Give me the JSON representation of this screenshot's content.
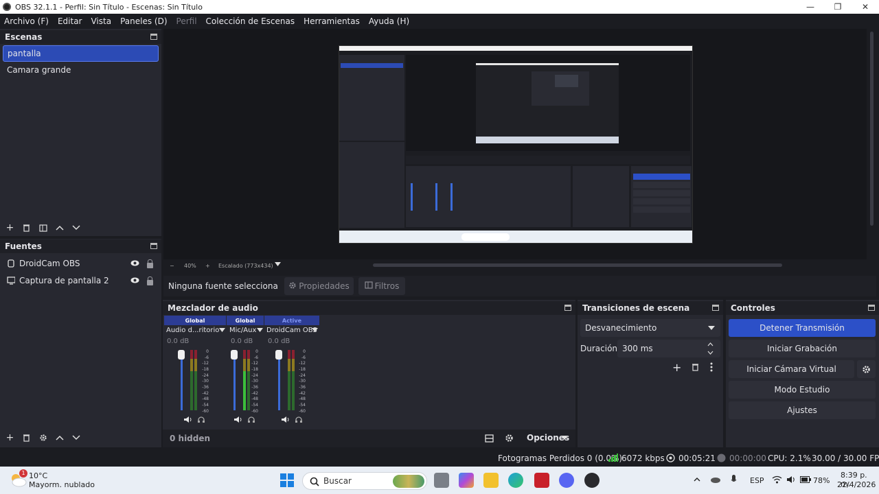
{
  "window": {
    "title": "OBS 32.1.1 - Perfil: Sin Título - Escenas: Sin Título",
    "controls": [
      "—",
      "❐",
      "✕"
    ]
  },
  "menu": [
    "Archivo (F)",
    "Editar",
    "Vista",
    "Paneles (D)",
    "Perfil",
    "Colección de Escenas",
    "Herramientas",
    "Ayuda (H)"
  ],
  "scenes": {
    "title": "Escenas",
    "items": [
      "pantalla",
      "Camara grande"
    ],
    "selected": 0
  },
  "sources": {
    "title": "Fuentes",
    "items": [
      {
        "label": "DroidCam OBS",
        "icon": "camera-icon"
      },
      {
        "label": "Captura de pantalla 2",
        "icon": "monitor-icon"
      }
    ]
  },
  "preview": {
    "zoom_label": "40%",
    "scale_label": "Escalado (773x434)",
    "minus": "−",
    "plus": "+"
  },
  "context_bar": {
    "no_source": "Ninguna fuente selecciona",
    "properties": "Propiedades",
    "filters": "Filtros"
  },
  "mixer": {
    "title": "Mezclador de audio",
    "hidden_label": "0 hidden",
    "channels": [
      {
        "header": "Global",
        "name": "Audio d...ritorio",
        "db": "0.0 dB",
        "active": false
      },
      {
        "header": "Global",
        "name": "Mic/Aux",
        "db": "0.0 dB",
        "active": false
      },
      {
        "header": "Active",
        "name": "DroidCam OBS",
        "db": "0.0 dB",
        "active": true
      }
    ],
    "scale": [
      "0",
      "-6",
      "-12",
      "-18",
      "-24",
      "-30",
      "-36",
      "-42",
      "-48",
      "-54",
      "-60"
    ],
    "options_label": "Opciones"
  },
  "transitions": {
    "title": "Transiciones de escena",
    "selected": "Desvanecimiento",
    "duration_label": "Duración",
    "duration_value": "300 ms"
  },
  "controls": {
    "title": "Controles",
    "buttons": {
      "stream": "Detener Transmisión",
      "record": "Iniciar Grabación",
      "virtual_cam": "Iniciar Cámara Virtual",
      "studio": "Modo Estudio",
      "settings": "Ajustes"
    }
  },
  "status": {
    "dropped": "Fotogramas Perdidos 0 (0.0%)",
    "bitrate": "6072 kbps",
    "stream_time": "00:05:21",
    "record_time": "00:00:00",
    "cpu": "CPU: 2.1%",
    "fps": "30.00 / 30.00 FPS"
  },
  "taskbar": {
    "weather_temp": "10°C",
    "weather_desc": "Mayorm. nublado",
    "weather_badge": "1",
    "search_placeholder": "Buscar",
    "lang": "ESP",
    "battery": "78%",
    "time": "8:39 p. m.",
    "date": "22/4/2026"
  },
  "colors": {
    "accent": "#2c50c8",
    "panel": "#272830",
    "background": "#1b1c21"
  }
}
